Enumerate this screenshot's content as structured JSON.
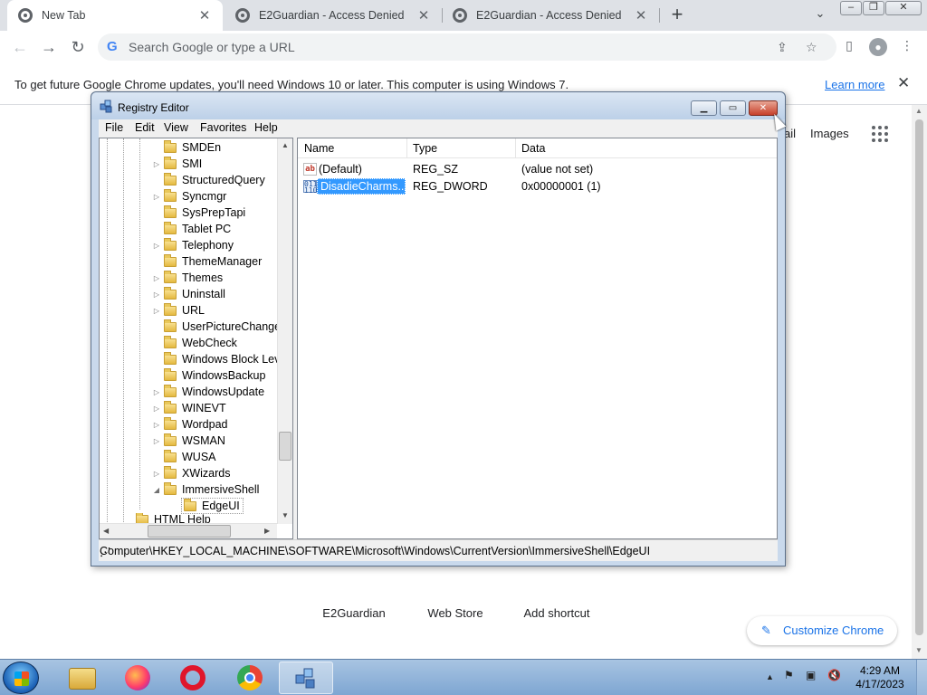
{
  "browser": {
    "tabs": [
      {
        "title": "New Tab",
        "close": "✕"
      },
      {
        "title": "E2Guardian - Access Denied",
        "close": "✕"
      },
      {
        "title": "E2Guardian - Access Denied",
        "close": "✕"
      }
    ],
    "new_tab": "+",
    "tab_search": "⌄",
    "window_controls": {
      "minimize": "–",
      "maximize": "❐",
      "close": "✕"
    },
    "omnibox_placeholder": "Search Google or type a URL",
    "nav": {
      "back": "←",
      "forward": "→",
      "reload": "↻"
    }
  },
  "infobar": {
    "message": "To get future Google Chrome updates, you'll need Windows 10 or later. This computer is using Windows 7.",
    "link": "Learn more",
    "close": "✕"
  },
  "ntp": {
    "gmail_partial": "ail",
    "images": "Images",
    "shortcuts": [
      {
        "label": "E2Guardian"
      },
      {
        "label": "Web Store"
      },
      {
        "label": "Add shortcut"
      }
    ],
    "customize": "Customize Chrome"
  },
  "regedit": {
    "title": "Registry Editor",
    "menu": [
      "File",
      "Edit",
      "View",
      "Favorites",
      "Help"
    ],
    "tree": [
      {
        "label": "SMDEn",
        "expander": ""
      },
      {
        "label": "SMI",
        "expander": "▷"
      },
      {
        "label": "StructuredQuery",
        "expander": ""
      },
      {
        "label": "Syncmgr",
        "expander": "▷"
      },
      {
        "label": "SysPrepTapi",
        "expander": ""
      },
      {
        "label": "Tablet PC",
        "expander": ""
      },
      {
        "label": "Telephony",
        "expander": "▷"
      },
      {
        "label": "ThemeManager",
        "expander": ""
      },
      {
        "label": "Themes",
        "expander": "▷"
      },
      {
        "label": "Uninstall",
        "expander": "▷"
      },
      {
        "label": "URL",
        "expander": "▷"
      },
      {
        "label": "UserPictureChange",
        "expander": ""
      },
      {
        "label": "WebCheck",
        "expander": ""
      },
      {
        "label": "Windows Block Lev",
        "expander": ""
      },
      {
        "label": "WindowsBackup",
        "expander": ""
      },
      {
        "label": "WindowsUpdate",
        "expander": "▷"
      },
      {
        "label": "WINEVT",
        "expander": "▷"
      },
      {
        "label": "Wordpad",
        "expander": "▷"
      },
      {
        "label": "WSMAN",
        "expander": "▷"
      },
      {
        "label": "WUSA",
        "expander": ""
      },
      {
        "label": "XWizards",
        "expander": "▷"
      },
      {
        "label": "ImmersiveShell",
        "expander": "◢"
      },
      {
        "label": "EdgeUI",
        "expander": ""
      },
      {
        "label": "HTML Help",
        "expander": ""
      }
    ],
    "columns": {
      "name": "Name",
      "type": "Type",
      "data": "Data"
    },
    "values": [
      {
        "name": "(Default)",
        "type": "REG_SZ",
        "data": "(value not set)",
        "icon": "string-value-icon"
      },
      {
        "name": "DisadieCharms...",
        "type": "REG_DWORD",
        "data": "0x00000001 (1)",
        "icon": "dword-value-icon"
      }
    ],
    "status_path": "Computer\\HKEY_LOCAL_MACHINE\\SOFTWARE\\Microsoft\\Windows\\CurrentVersion\\ImmersiveShell\\EdgeUI"
  },
  "taskbar": {
    "clock_time": "4:29 AM",
    "clock_date": "4/17/2023",
    "tray_arrow": "▲"
  },
  "colors": {
    "chrome_tabstrip": "#dee1e6",
    "accent_blue": "#1a73e8",
    "selection": "#3399ff",
    "taskbar": "#8fb2d9"
  }
}
